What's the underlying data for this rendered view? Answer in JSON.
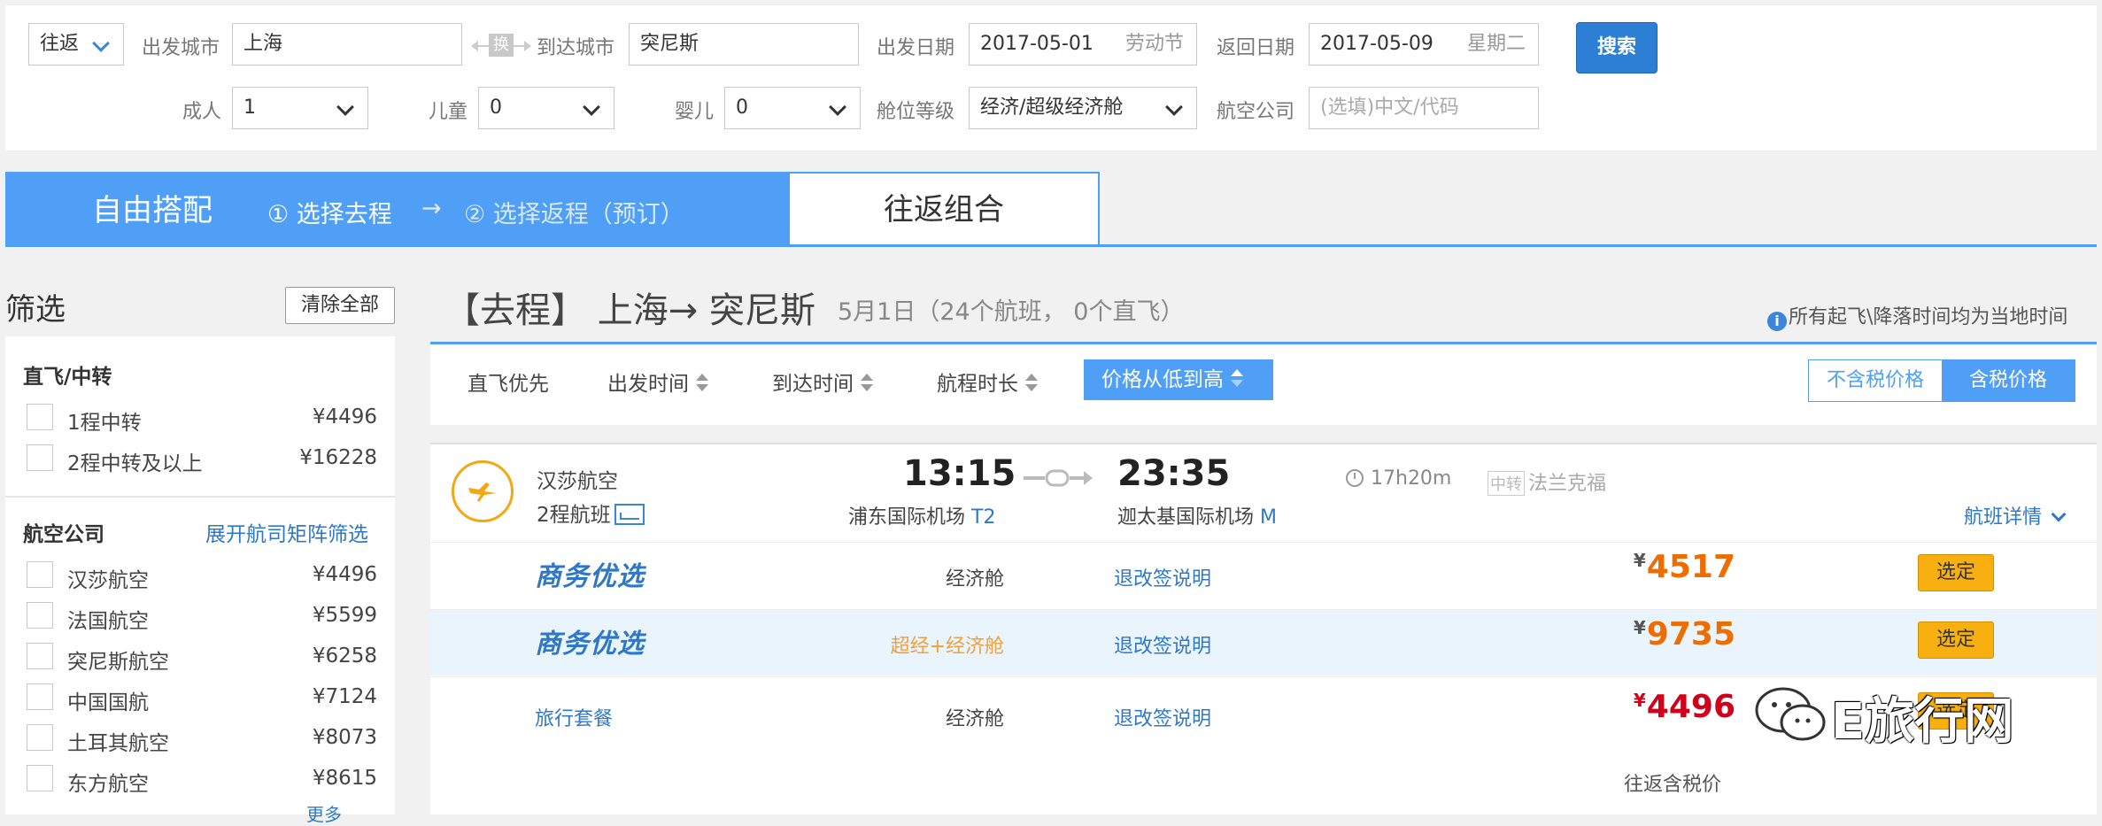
{
  "search": {
    "trip_type": "往返",
    "depart_city_label": "出发城市",
    "depart_city": "上海",
    "swap_label": "换",
    "arrive_city_label": "到达城市",
    "arrive_city": "突尼斯",
    "depart_date_label": "出发日期",
    "depart_date": "2017-05-01",
    "depart_date_hint": "劳动节",
    "return_date_label": "返回日期",
    "return_date": "2017-05-09",
    "return_date_hint": "星期二",
    "search_button": "搜索",
    "adult_label": "成人",
    "adult_value": "1",
    "child_label": "儿童",
    "child_value": "0",
    "infant_label": "婴儿",
    "infant_value": "0",
    "cabin_label": "舱位等级",
    "cabin_value": "经济/超级经济舱",
    "airline_label": "航空公司",
    "airline_placeholder": "(选填)中文/代码"
  },
  "mode": {
    "free_combo": "自由搭配",
    "step1": "① 选择去程",
    "arrow": "→",
    "step2": "② 选择返程（预订）",
    "round_combo": "往返组合"
  },
  "filter": {
    "title": "筛选",
    "clear_all": "清除全部",
    "stops_heading": "直飞/中转",
    "stops": [
      {
        "label": "1程中转",
        "price": "¥4496"
      },
      {
        "label": "2程中转及以上",
        "price": "¥16228"
      }
    ],
    "airline_heading": "航空公司",
    "airline_matrix_link": "展开航司矩阵筛选",
    "airlines": [
      {
        "label": "汉莎航空",
        "price": "¥4496"
      },
      {
        "label": "法国航空",
        "price": "¥5599"
      },
      {
        "label": "突尼斯航空",
        "price": "¥6258"
      },
      {
        "label": "中国国航",
        "price": "¥7124"
      },
      {
        "label": "土耳其航空",
        "price": "¥8073"
      },
      {
        "label": "东方航空",
        "price": "¥8615"
      }
    ],
    "more": "更多"
  },
  "results": {
    "title": "【去程】 上海→ 突尼斯",
    "subtitle": "5月1日（24个航班， 0个直飞）",
    "tz_note": "所有起飞\\降落时间均为当地时间",
    "sort": {
      "direct_first": "直飞优先",
      "depart_time": "出发时间",
      "arrive_time": "到达时间",
      "duration": "航程时长",
      "price_low_high": "价格从低到高"
    },
    "tax_toggle": {
      "excl": "不含税价格",
      "incl": "含税价格"
    }
  },
  "flight": {
    "airline": "汉莎航空",
    "stops": "2程航班",
    "depart_time": "13:15",
    "depart_airport": "浦东国际机场",
    "depart_terminal": "T2",
    "arrive_time": "23:35",
    "arrive_airport": "迦太基国际机场",
    "arrive_terminal": "M",
    "duration": "17h20m",
    "transfer_tag": "中转",
    "transfer_city": "法兰克福",
    "details_link": "航班详情",
    "fares": [
      {
        "brand": "商务优选",
        "cabin": "经济舱",
        "rule": "退改签说明",
        "currency": "¥",
        "price": "4517",
        "select": "选定",
        "cabin_color": "#444444",
        "price_color": "#ef6c00"
      },
      {
        "brand": "商务优选",
        "cabin": "超经+经济舱",
        "rule": "退改签说明",
        "currency": "¥",
        "price": "9735",
        "select": "选定",
        "cabin_color": "#f0a040",
        "price_color": "#ef6c00"
      },
      {
        "brand": "旅行套餐",
        "cabin": "经济舱",
        "rule": "退改签说明",
        "currency": "¥",
        "price": "4496",
        "select": "选定",
        "cabin_color": "#444444",
        "price_color": "#d0021b"
      }
    ],
    "round_trip_tax_note": "往返含税价"
  },
  "watermark": {
    "text": "E旅行网"
  },
  "colors": {
    "accent": "#4e9ff5",
    "link": "#2f78c8",
    "price": "#ef6c00",
    "select_button": "#f7b010",
    "search_button": "#2d7fd6"
  }
}
